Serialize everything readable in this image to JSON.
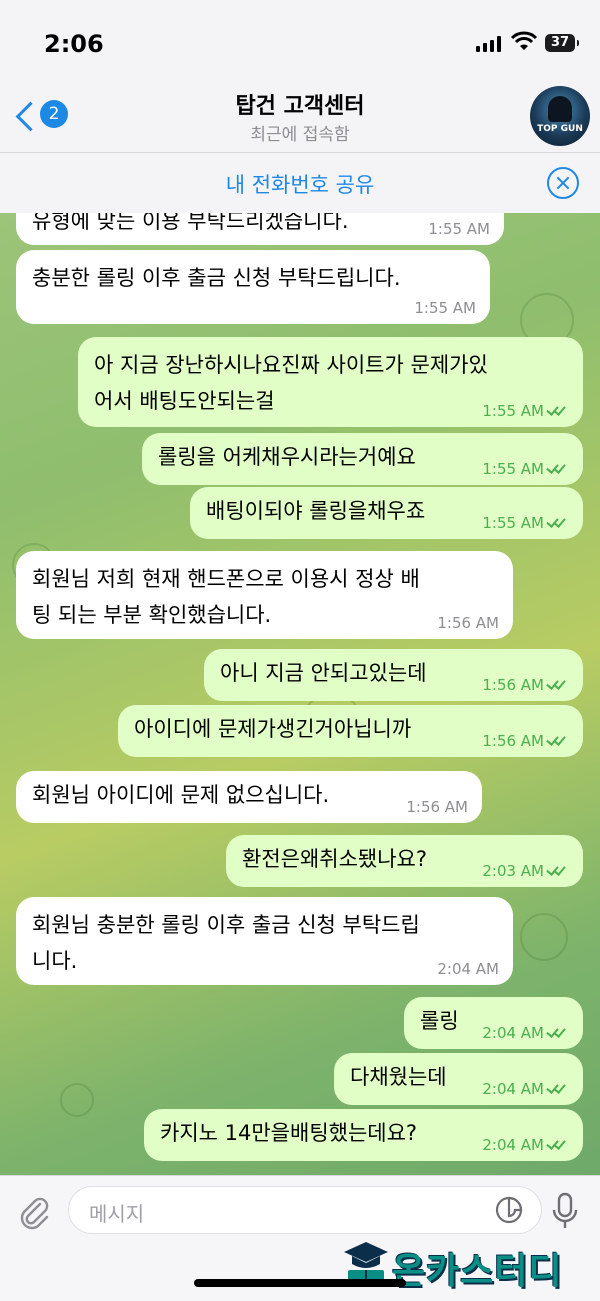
{
  "status_bar": {
    "time": "2:06",
    "battery": "37"
  },
  "header": {
    "back_badge": "2",
    "title": "탑건 고객센터",
    "subtitle": "최근에 접속함",
    "avatar_text": "TOP GUN"
  },
  "share_bar": {
    "label": "내 전화번호 공유"
  },
  "messages": [
    {
      "dir": "in",
      "lines": [
        "유형에 맞는 이용 부탁드리겠습니다."
      ],
      "time": "1:55 AM"
    },
    {
      "dir": "in",
      "lines": [
        "충분한 롤링 이후 출금 신청 부탁드립니다."
      ],
      "time": "1:55 AM"
    },
    {
      "dir": "out",
      "lines": [
        "아 지금 장난하시나요진짜 사이트가 문제가있",
        "어서 배팅도안되는걸"
      ],
      "time": "1:55 AM"
    },
    {
      "dir": "out",
      "lines": [
        "롤링을 어케채우시라는거예요"
      ],
      "time": "1:55 AM"
    },
    {
      "dir": "out",
      "lines": [
        "배팅이되야 롤링을채우죠"
      ],
      "time": "1:55 AM"
    },
    {
      "dir": "in",
      "lines": [
        "회원님 저희 현재 핸드폰으로 이용시 정상 배",
        "팅 되는 부분 확인했습니다."
      ],
      "time": "1:56 AM"
    },
    {
      "dir": "out",
      "lines": [
        "아니 지금 안되고있는데"
      ],
      "time": "1:56 AM"
    },
    {
      "dir": "out",
      "lines": [
        "아이디에 문제가생긴거아닙니까"
      ],
      "time": "1:56 AM"
    },
    {
      "dir": "in",
      "lines": [
        "회원님 아이디에 문제 없으십니다."
      ],
      "time": "1:56 AM"
    },
    {
      "dir": "out",
      "lines": [
        "환전은왜취소됐나요?"
      ],
      "time": "2:03 AM"
    },
    {
      "dir": "in",
      "lines": [
        "회원님 충분한 롤링 이후 출금 신청 부탁드립",
        "니다."
      ],
      "time": "2:04 AM"
    },
    {
      "dir": "out",
      "lines": [
        "롤링"
      ],
      "time": "2:04 AM"
    },
    {
      "dir": "out",
      "lines": [
        "다채웠는데"
      ],
      "time": "2:04 AM"
    },
    {
      "dir": "out",
      "lines": [
        "카지노 14만을배팅했는데요?"
      ],
      "time": "2:04 AM"
    }
  ],
  "input": {
    "placeholder": "메시지"
  },
  "watermark": {
    "text": "온카스터디"
  },
  "colors": {
    "accent": "#1e88e5",
    "outgoing_bubble": "#e1fec6",
    "incoming_bubble": "#ffffff",
    "read_check": "#4caf50"
  },
  "icons": [
    "back-chevron-icon",
    "close-circle-icon",
    "attach-paperclip-icon",
    "sticker-icon",
    "microphone-icon",
    "double-check-icon"
  ]
}
